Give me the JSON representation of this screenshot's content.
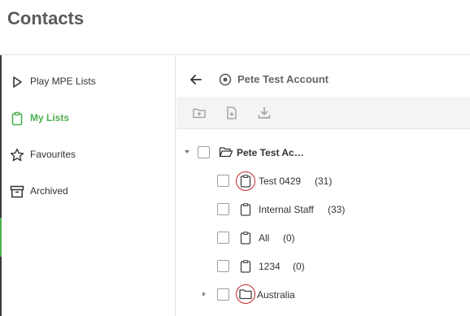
{
  "header": {
    "title": "Contacts"
  },
  "sidebar": {
    "items": [
      {
        "label": "Play MPE Lists",
        "icon": "play-icon",
        "active": false
      },
      {
        "label": "My Lists",
        "icon": "clipboard-icon",
        "active": true
      },
      {
        "label": "Favourites",
        "icon": "star-icon",
        "active": false
      },
      {
        "label": "Archived",
        "icon": "archive-icon",
        "active": false
      }
    ]
  },
  "main": {
    "title": "Pete Test Account",
    "toolbar": {
      "buttons": [
        {
          "icon": "new-folder-icon"
        },
        {
          "icon": "new-list-icon"
        },
        {
          "icon": "download-icon"
        }
      ]
    },
    "tree": {
      "root": {
        "label": "Pete Test Ac…",
        "icon": "folder-open-icon"
      },
      "children": [
        {
          "label": "Test 0429",
          "count": "(31)",
          "icon": "clipboard-icon"
        },
        {
          "label": "Internal Staff",
          "count": "(33)",
          "icon": "clipboard-icon"
        },
        {
          "label": "All",
          "count": "(0)",
          "icon": "clipboard-icon"
        },
        {
          "label": "1234",
          "count": "(0)",
          "icon": "clipboard-icon"
        },
        {
          "label": "Australia",
          "icon": "folder-icon"
        }
      ]
    }
  },
  "colors": {
    "accent": "#4caf50",
    "annotation": "#c62828",
    "toolbar_bg": "#f4f4f4"
  }
}
